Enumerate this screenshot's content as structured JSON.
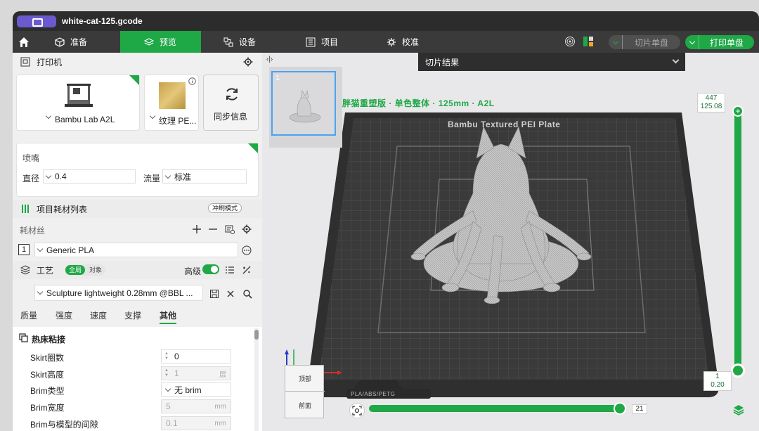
{
  "window": {
    "title": "white-cat-125.gcode"
  },
  "topnav": {
    "tabs": [
      {
        "label": "准备",
        "icon": "cube-icon"
      },
      {
        "label": "预览",
        "icon": "layers-icon",
        "active": true
      },
      {
        "label": "设备",
        "icon": "device-icon"
      },
      {
        "label": "项目",
        "icon": "list-icon"
      },
      {
        "label": "校准",
        "icon": "calibrate-icon"
      }
    ],
    "slice_label": "切片单盘",
    "print_label": "打印单盘"
  },
  "printer": {
    "section_title": "打印机",
    "printer_name": "Bambu Lab A2L",
    "plate_name": "纹理 PE...",
    "sync_label": "同步信息"
  },
  "nozzle": {
    "title": "喷嘴",
    "diameter_label": "直径",
    "diameter_value": "0.4",
    "flow_label": "流量",
    "flow_value": "标准"
  },
  "filament": {
    "section_title": "项目耗材列表",
    "mode_badge": "冲刷模式",
    "sub_label": "耗材丝",
    "slot_number": "1",
    "filament_name": "Generic PLA"
  },
  "process": {
    "section_title": "工艺",
    "toggle_global": "全局",
    "toggle_object": "对象",
    "advanced_label": "高级",
    "profile_name": "Sculpture lightweight 0.28mm @BBL ...",
    "tabs": [
      "质量",
      "强度",
      "速度",
      "支撑",
      "其他"
    ],
    "active_tab_index": 4
  },
  "params": {
    "group_title": "热床粘接",
    "rows": [
      {
        "name": "Skirt圈数",
        "value": "0",
        "unit": "",
        "disabled": false,
        "spinner": true
      },
      {
        "name": "Skirt高度",
        "value": "1",
        "unit": "层",
        "disabled": true,
        "spinner": true
      },
      {
        "name": "Brim类型",
        "value": "无 brim",
        "unit": "",
        "disabled": false,
        "spinner": false
      },
      {
        "name": "Brim宽度",
        "value": "5",
        "unit": "mm",
        "disabled": true,
        "spinner": false
      },
      {
        "name": "Brim与模型的间隙",
        "value": "0.1",
        "unit": "mm",
        "disabled": true,
        "spinner": false
      }
    ]
  },
  "viewport": {
    "slice_result_label": "切片结果",
    "thumb_number": "1",
    "plate_label": "胖猫重塑版 · 单色整体 · 125mm · A2L",
    "bed_label": "Bambu Textured PEI Plate",
    "bed_material_label": "PLA/ABS/PETG",
    "layer_top": "447",
    "height_top": "125.08",
    "layer_bottom": "1",
    "height_bottom": "0.20",
    "move_value": "21",
    "view_top": "顶部",
    "view_front": "前面",
    "layer_fill": 1.0,
    "move_fill": 1.0
  }
}
